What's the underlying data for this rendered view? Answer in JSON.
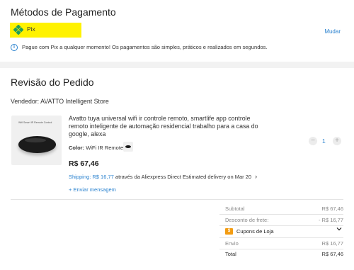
{
  "payment": {
    "title": "Métodos de Pagamento",
    "method_label": "Pix",
    "change_label": "Mudar",
    "info_text": "Pague com Pix a qualquer momento! Os pagamentos são simples, práticos e realizados em segundos."
  },
  "review": {
    "title": "Revisão do Pedido",
    "seller": "Vendedor: AVATTO Intelligent Store",
    "product": {
      "image_caption": "Wifi Smart IR Remote Control",
      "name": "Avatto tuya universal wifi ir controle remoto, smartlife app controle remoto inteligente de automação residencial trabalho para a casa do google, alexa",
      "color_label": "Color:",
      "color_value": "WiFi IR Remote",
      "price": "R$ 67,46",
      "shipping_label": "Shipping: R$ 16,77",
      "shipping_detail": "através da Aliexpress Direct  Estimated delivery on Mar 20",
      "send_message": "+ Enviar mensagem",
      "quantity": "1",
      "qty_minus": "−",
      "qty_plus": "+"
    },
    "summary": {
      "subtotal_label": "Subtotal",
      "subtotal_value": "R$ 67,46",
      "discount_label": "Desconto de frete:",
      "discount_value": "- R$ 16,77",
      "coupon_badge": "$",
      "coupon_label": "Cupons de Loja",
      "shipping_label": "Envio",
      "shipping_value": "R$ 16,77",
      "total_label": "Total",
      "total_value": "R$ 67,46"
    }
  },
  "colors": {
    "highlight": "#fff200",
    "link": "#2a82cf",
    "coupon": "#f39c12",
    "pix_green": "#32bcad"
  },
  "icons": [
    "pix-icon",
    "info-icon",
    "chevron-right-icon",
    "chevron-down-icon",
    "coupon-icon"
  ]
}
